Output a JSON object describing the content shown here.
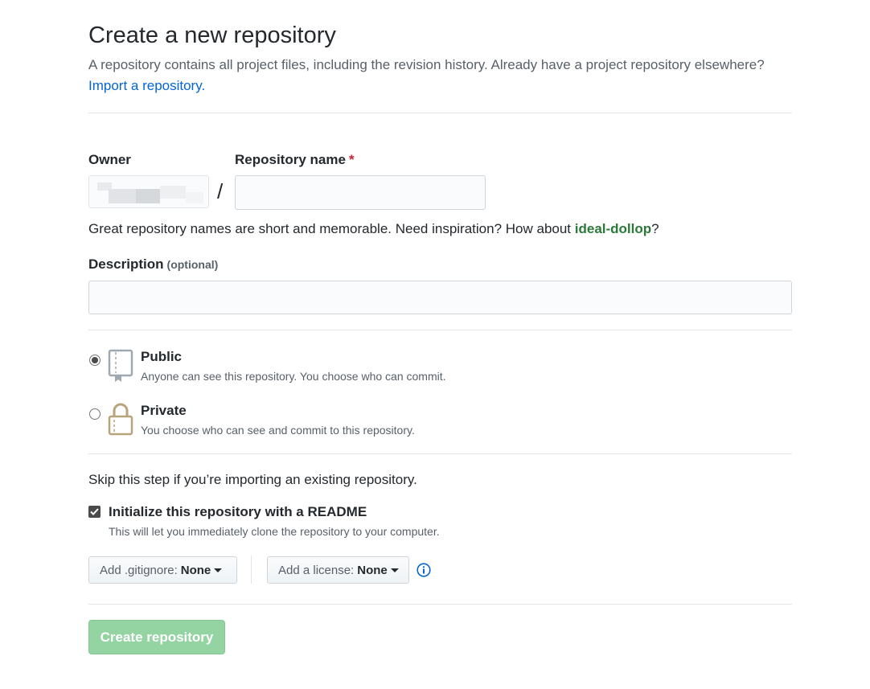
{
  "header": {
    "title": "Create a new repository",
    "subtitle": "A repository contains all project files, including the revision history. Already have a project repository elsewhere?",
    "import_link": "Import a repository."
  },
  "owner": {
    "label": "Owner"
  },
  "repo_name": {
    "label": "Repository name",
    "required_mark": "*",
    "value": "",
    "separator": "/"
  },
  "hint": {
    "prefix": "Great repository names are short and memorable. Need inspiration? How about",
    "suggestion": "ideal-dollop",
    "suffix": "?"
  },
  "description": {
    "label": "Description",
    "optional": "(optional)",
    "value": ""
  },
  "visibility": {
    "selected": "public",
    "public": {
      "title": "Public",
      "desc": "Anyone can see this repository. You choose who can commit."
    },
    "private": {
      "title": "Private",
      "desc": "You choose who can see and commit to this repository."
    }
  },
  "init": {
    "skip_text": "Skip this step if you’re importing an existing repository.",
    "readme_label": "Initialize this repository with a README",
    "readme_desc": "This will let you immediately clone the repository to your computer.",
    "readme_checked": true
  },
  "gitignore": {
    "label": "Add .gitignore:",
    "value": "None"
  },
  "license": {
    "label": "Add a license:",
    "value": "None"
  },
  "submit": {
    "label": "Create repository"
  },
  "colors": {
    "link": "#0366d6",
    "submit_bg": "#94d3a2",
    "book_icon": "#a0a8b0",
    "lock_icon": "#b8a47a"
  },
  "icons": {
    "info": "info-icon",
    "public": "repo-book-icon",
    "private": "lock-icon",
    "dropdown": "caret-down-icon",
    "check": "check-icon"
  }
}
